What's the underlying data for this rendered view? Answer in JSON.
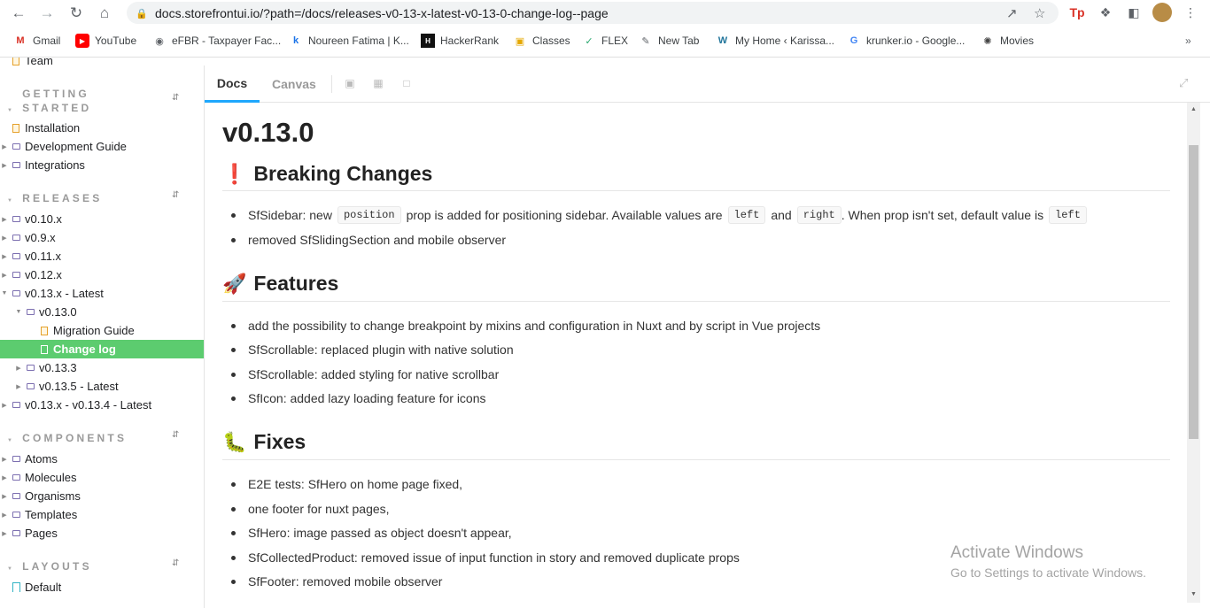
{
  "browser": {
    "url": "docs.storefrontui.io/?path=/docs/releases-v0-13-x-latest-v0-13-0-change-log--page",
    "bookmarks": [
      {
        "label": "Gmail",
        "icon": "gmail-icon"
      },
      {
        "label": "YouTube",
        "icon": "youtube-icon"
      },
      {
        "label": "eFBR - Taxpayer Fac...",
        "icon": "globe-icon"
      },
      {
        "label": "Noureen Fatima | K...",
        "icon": "k-icon"
      },
      {
        "label": "HackerRank",
        "icon": "hackerrank-icon"
      },
      {
        "label": "Classes",
        "icon": "classes-icon"
      },
      {
        "label": "FLEX",
        "icon": "flex-icon"
      },
      {
        "label": "New Tab",
        "icon": "newtab-icon"
      },
      {
        "label": "My Home ‹ Karissa...",
        "icon": "wordpress-icon"
      },
      {
        "label": "krunker.io - Google...",
        "icon": "google-icon"
      },
      {
        "label": "Movies",
        "icon": "movies-icon"
      }
    ],
    "colors": {
      "accent": "#1ea7fd",
      "active_item": "#5ccc6f"
    }
  },
  "sidebar": {
    "top_item": "Team",
    "sections": {
      "getting_started": "GETTING STARTED",
      "releases": "RELEASES",
      "components": "COMPONENTS",
      "layouts": "LAYOUTS"
    },
    "getting_started_items": [
      "Installation",
      "Development Guide",
      "Integrations"
    ],
    "releases_items": [
      "v0.10.x",
      "v0.9.x",
      "v0.11.x",
      "v0.12.x",
      "v0.13.x - Latest",
      "v0.13.0",
      "Migration Guide",
      "Change log",
      "v0.13.3",
      "v0.13.5 - Latest",
      "v0.13.x - v0.13.4 - Latest"
    ],
    "components_items": [
      "Atoms",
      "Molecules",
      "Organisms",
      "Templates",
      "Pages"
    ],
    "layouts_items": [
      "Default"
    ]
  },
  "tabs": {
    "docs": "Docs",
    "canvas": "Canvas"
  },
  "doc": {
    "title": "v0.13.0",
    "breaking": {
      "heading": "Breaking Changes",
      "emoji": "❗",
      "item1": {
        "a": "SfSidebar: new",
        "code1": "position",
        "b": "prop is added for positioning sidebar. Available values are",
        "code2": "left",
        "c": "and",
        "code3": "right",
        "d": ". When prop isn't set, default value is",
        "code4": "left"
      },
      "item2": "removed SfSlidingSection and mobile observer"
    },
    "features": {
      "heading": "Features",
      "emoji": "🚀",
      "items": [
        "add the possibility to change breakpoint by mixins and configuration in Nuxt and by script in Vue projects",
        "SfScrollable: replaced plugin with native solution",
        "SfScrollable: added styling for native scrollbar",
        "SfIcon: added lazy loading feature for icons"
      ]
    },
    "fixes": {
      "heading": "Fixes",
      "emoji": "🐛",
      "items": [
        "E2E tests: SfHero on home page fixed,",
        "one footer for nuxt pages,",
        "SfHero: image passed as object doesn't appear,",
        "SfCollectedProduct: removed issue of input function in story and removed duplicate props",
        "SfFooter: removed mobile observer"
      ]
    }
  },
  "watermark": {
    "line1": "Activate Windows",
    "line2": "Go to Settings to activate Windows."
  }
}
